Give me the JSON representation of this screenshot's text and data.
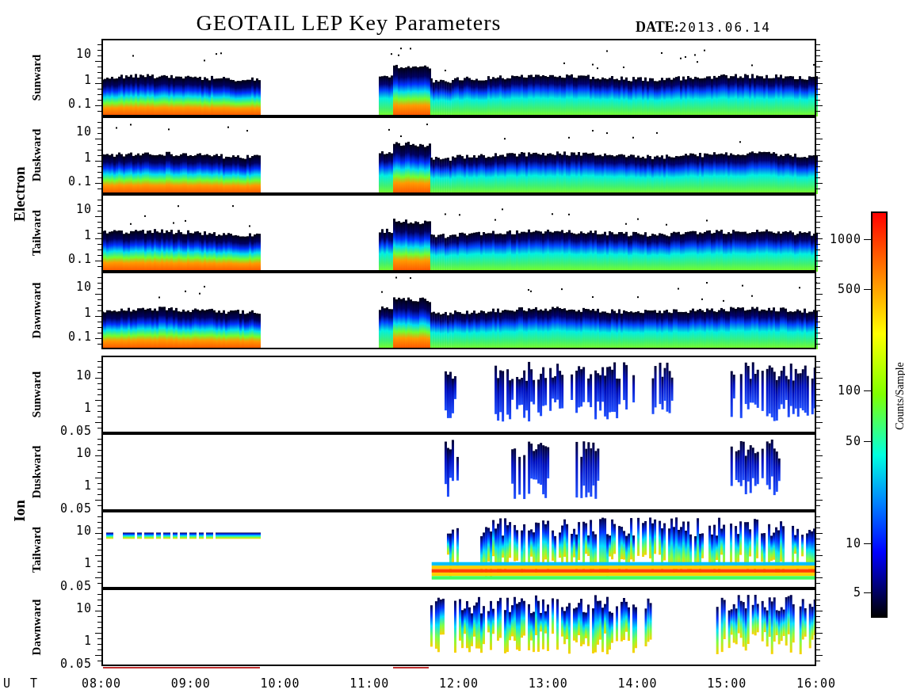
{
  "title": "GEOTAIL LEP Key Parameters",
  "date": {
    "label": "DATE:",
    "value": "2013.06.14"
  },
  "groups": [
    {
      "name": "Electron",
      "kind": "electron",
      "panels": [
        {
          "label": "Sunward",
          "yticks": [
            "10",
            "1",
            "0.1"
          ]
        },
        {
          "label": "Duskward",
          "yticks": [
            "10",
            "1",
            "0.1"
          ]
        },
        {
          "label": "Tailward",
          "yticks": [
            "10",
            "1",
            "0.1"
          ]
        },
        {
          "label": "Dawnward",
          "yticks": [
            "10",
            "1",
            "0.1"
          ]
        }
      ]
    },
    {
      "name": "Ion",
      "kind": "ion",
      "panels": [
        {
          "label": "Sunward",
          "yticks": [
            "10",
            "1",
            "0.05"
          ]
        },
        {
          "label": "Duskward",
          "yticks": [
            "10",
            "1",
            "0.05"
          ]
        },
        {
          "label": "Tailward",
          "yticks": [
            "10",
            "1",
            "0.05"
          ]
        },
        {
          "label": "Dawnward",
          "yticks": [
            "10",
            "1",
            "0.05"
          ]
        }
      ]
    }
  ],
  "time_axis": {
    "label": "U T",
    "ticks": [
      "08:00",
      "09:00",
      "10:00",
      "11:00",
      "12:00",
      "13:00",
      "14:00",
      "15:00",
      "16:00"
    ]
  },
  "colorbar": {
    "title": "Counts/Sample",
    "ticks": [
      "1000",
      "500",
      "100",
      "50",
      "10",
      "5"
    ]
  }
}
